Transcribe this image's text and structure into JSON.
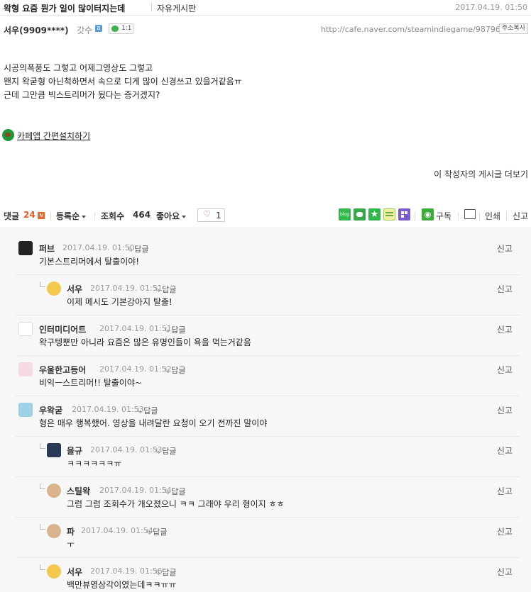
{
  "post": {
    "title": "왁형 요즘 뭔가 일이 많이터지는데",
    "board": "자유게시판",
    "date": "2017.04.19. 01:50",
    "author": "서우(9909****)",
    "grade": "갓수",
    "chat_count": "1:1",
    "url": "http://cafe.naver.com/steamindiegame/98796",
    "copy_url": "주소복사",
    "body": [
      "시공의폭풍도 그렇고 어제그영상도 그렇고",
      "왠지 왁굳형 아닌척하면서 속으로 디게 많이 신경쓰고 있을거같음ㅠ",
      "근데 그만큼 빅스트리머가 됬다는 증거겠지?"
    ],
    "app_install": "카페앱 간편설치하기",
    "more_posts": "이 작성자의 게시글 더보기"
  },
  "actions": {
    "comment_label": "댓글",
    "comment_count": "24",
    "new_badge": "N",
    "order_label": "등록순",
    "views_label": "조회수",
    "views_count": "464",
    "like_label": "좋아요",
    "like_count": "1",
    "subscribe": "구독",
    "print": "인쇄",
    "report": "신고"
  },
  "comments": [
    {
      "name": "퍼브",
      "date": "2017.04.19. 01:50",
      "reply": "답글",
      "text": "기본스트리머에서 탈출이야!",
      "report": "신고"
    },
    {
      "name": "서우",
      "date": "2017.04.19. 01:51",
      "reply": "답글",
      "text": "이제 메시도 기본강아지 탈출!",
      "report": "신고"
    },
    {
      "name": "인터미디어트",
      "date": "2017.04.19. 01:51",
      "reply": "답글",
      "text": "왁구텡뿐만 아니라 요즘은 많은 유명인들이 욕을 먹는거같음",
      "report": "신고"
    },
    {
      "name": "우울한고등어",
      "date": "2017.04.19. 01:52",
      "reply": "답글",
      "text": "비익ㅡ스트리머!! 탈출이야~",
      "report": "신고"
    },
    {
      "name": "우왁굳",
      "date": "2017.04.19. 01:53",
      "reply": "답글",
      "text": "형은 매우 행복했어. 영상을 내려달란 요청이 오기 전까진 말이야",
      "report": "신고"
    },
    {
      "name": "을규",
      "date": "2017.04.19. 01:53",
      "reply": "답글",
      "text": "ㅋㅋㅋㅋㅋㅋㅠ",
      "report": "신고"
    },
    {
      "name": "스틸왁",
      "date": "2017.04.19. 01:54",
      "reply": "답글",
      "text": "그럼 그럼 조회수가 개오졌으니 ㅋㅋ 그래야 우리 형이지 ㅎㅎ",
      "report": "신고"
    },
    {
      "name": "파",
      "date": "2017.04.19. 01:54",
      "reply": "답글",
      "text": "ㅜ",
      "report": "신고"
    },
    {
      "name": "서우",
      "date": "2017.04.19. 01:56",
      "reply": "답글",
      "text": "백만뷰영상각이였는데ㅋㅋㅠㅠ",
      "report": "신고"
    }
  ],
  "colors": {
    "accent_count": "#e35b26",
    "comment_bg": "#f7f7f7",
    "like_heart": "#e04040"
  }
}
